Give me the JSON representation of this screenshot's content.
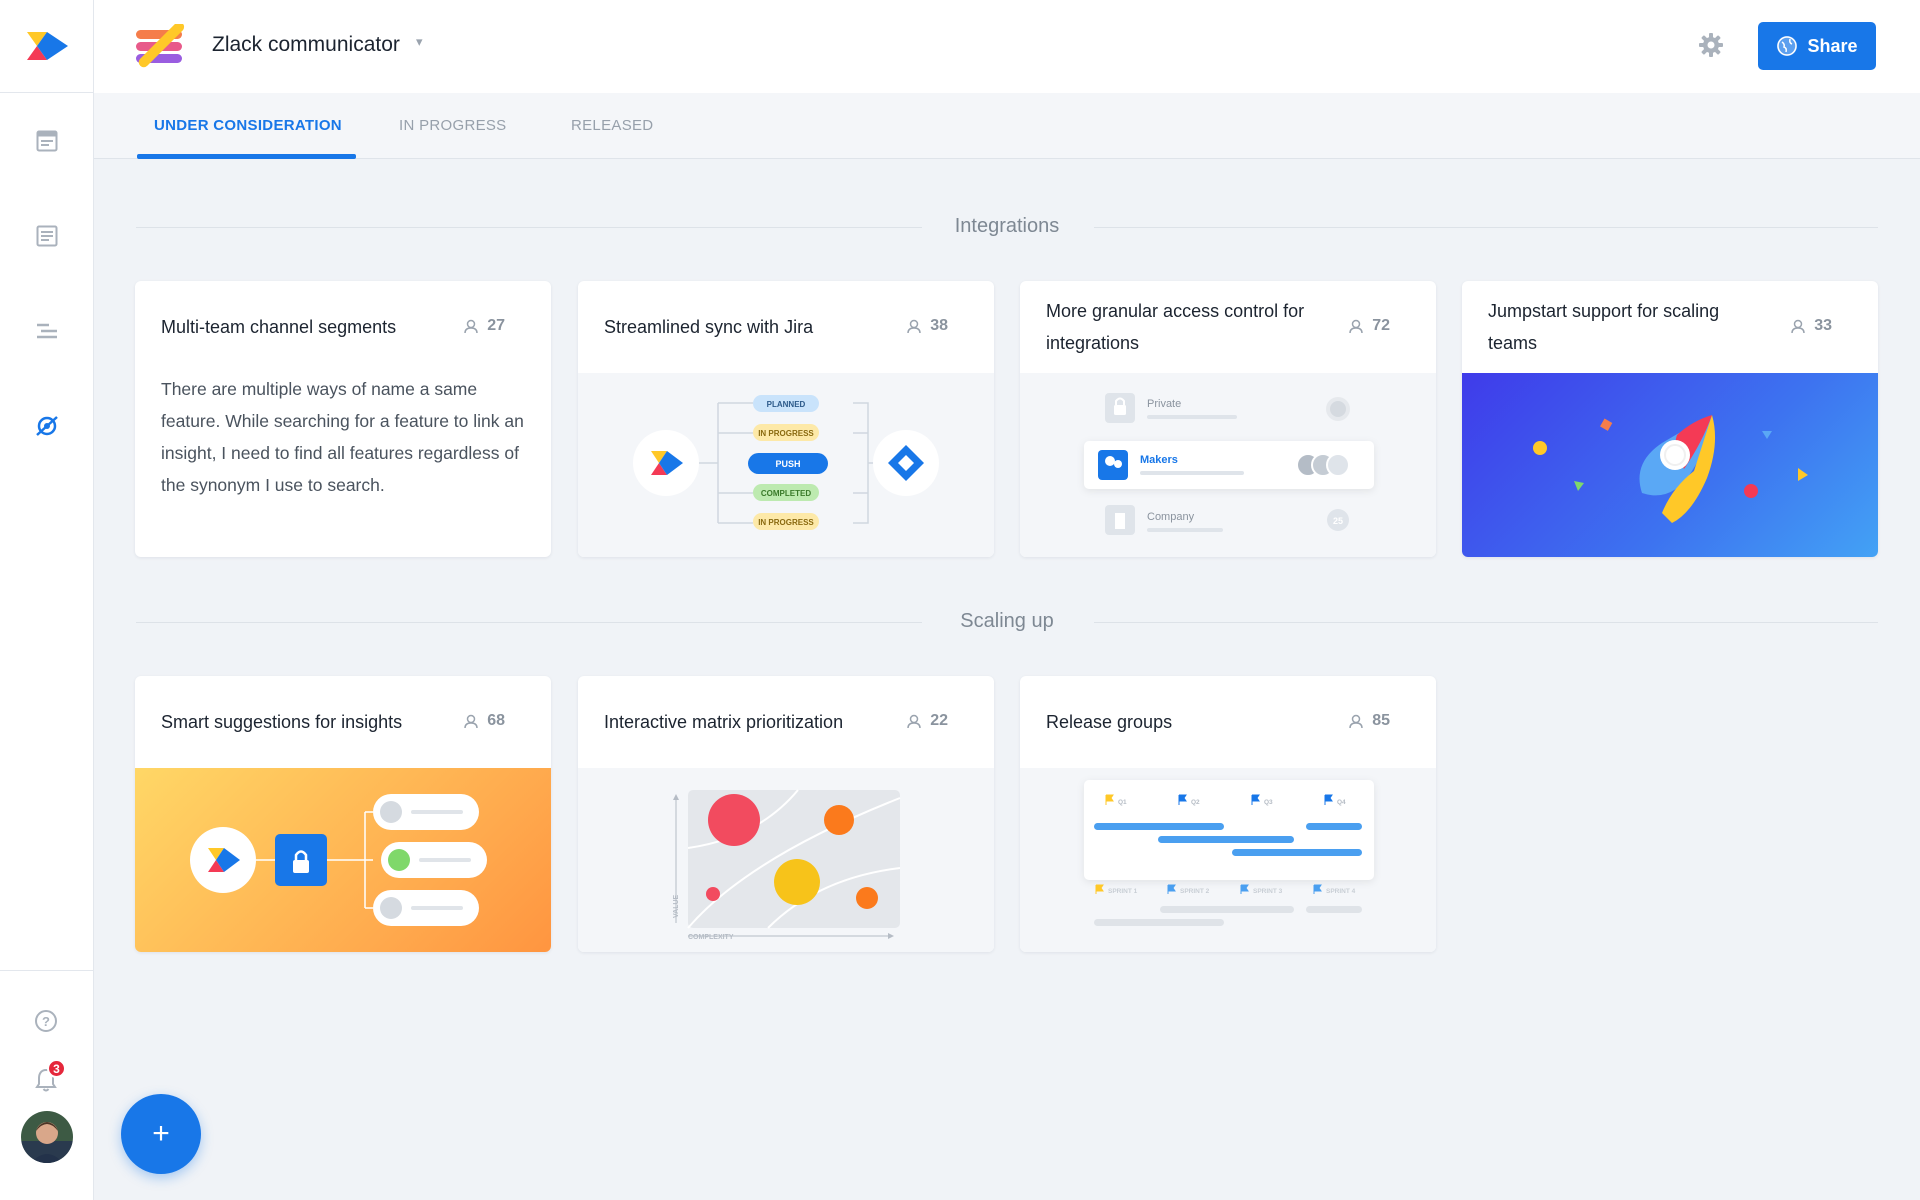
{
  "app": {
    "title": "Zlack communicator"
  },
  "header": {
    "share_label": "Share"
  },
  "tabs": [
    {
      "label": "UNDER CONSIDERATION",
      "active": true
    },
    {
      "label": "IN PROGRESS",
      "active": false
    },
    {
      "label": "RELEASED",
      "active": false
    }
  ],
  "sidebar": {
    "items": [
      {
        "icon": "document-icon"
      },
      {
        "icon": "notes-icon"
      },
      {
        "icon": "roadmap-icon"
      },
      {
        "icon": "portal-icon",
        "active": true
      }
    ],
    "notifications_count": "3"
  },
  "sections": [
    {
      "title": "Integrations",
      "cards": [
        {
          "title": "Multi-team channel segments",
          "votes": "27",
          "description": "There are multiple ways of name a same feature. While searching for a feature to link an insight, I need to find all features regardless of the synonym I use to search."
        },
        {
          "title": "Streamlined sync with Jira",
          "votes": "38",
          "illustration": {
            "statuses": [
              "PLANNED",
              "IN PROGRESS",
              "PUSH",
              "COMPLETED",
              "IN PROGRESS"
            ]
          }
        },
        {
          "title": "More granular access control for integrations",
          "votes": "72",
          "illustration": {
            "rows": [
              "Private",
              "Makers",
              "Company"
            ],
            "company_count": "25"
          }
        },
        {
          "title": "Jumpstart support for scaling teams",
          "votes": "33"
        }
      ]
    },
    {
      "title": "Scaling up",
      "cards": [
        {
          "title": "Smart suggestions for insights",
          "votes": "68"
        },
        {
          "title": "Interactive matrix prioritization",
          "votes": "22",
          "illustration": {
            "y_label": "VALUE",
            "x_label": "COMPLEXITY"
          }
        },
        {
          "title": "Release groups",
          "votes": "85",
          "illustration": {
            "quarters": [
              "Q1",
              "Q2",
              "Q3",
              "Q4"
            ],
            "sprints": [
              "SPRINT 1",
              "SPRINT 2",
              "SPRINT 3",
              "SPRINT 4"
            ]
          }
        }
      ]
    }
  ],
  "colors": {
    "accent": "#1877e8",
    "badge": "#e5273b",
    "background": "#f0f3f7"
  }
}
